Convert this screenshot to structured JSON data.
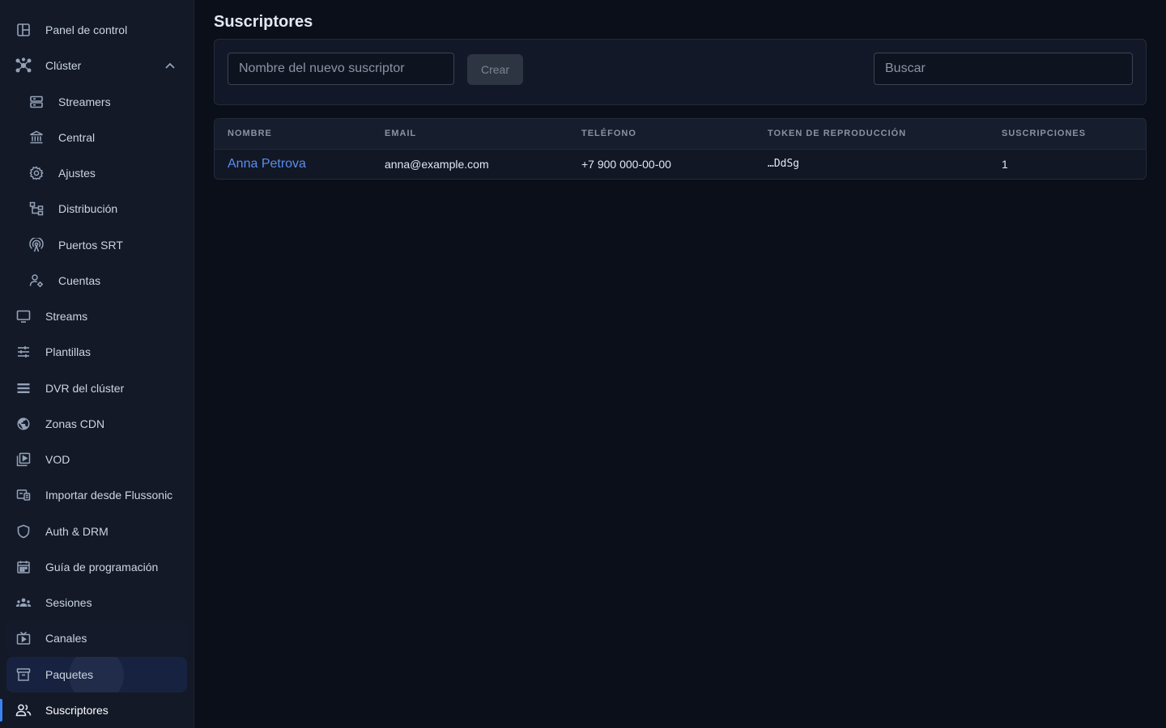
{
  "sidebar": {
    "items": [
      {
        "label": "Panel de control",
        "icon": "dashboard-icon"
      },
      {
        "label": "Clúster",
        "icon": "cluster-icon"
      },
      {
        "label": "Streamers",
        "icon": "server-icon"
      },
      {
        "label": "Central",
        "icon": "bank-icon"
      },
      {
        "label": "Ajustes",
        "icon": "gear-icon"
      },
      {
        "label": "Distribución",
        "icon": "distribution-icon"
      },
      {
        "label": "Puertos SRT",
        "icon": "antenna-icon"
      },
      {
        "label": "Cuentas",
        "icon": "user-settings-icon"
      },
      {
        "label": "Streams",
        "icon": "monitor-icon"
      },
      {
        "label": "Plantillas",
        "icon": "sliders-icon"
      },
      {
        "label": "DVR del clúster",
        "icon": "list-icon"
      },
      {
        "label": "Zonas CDN",
        "icon": "globe-icon"
      },
      {
        "label": "VOD",
        "icon": "video-library-icon"
      },
      {
        "label": "Importar desde Flussonic",
        "icon": "import-icon"
      },
      {
        "label": "Auth & DRM",
        "icon": "shield-icon"
      },
      {
        "label": "Guía de programación",
        "icon": "calendar-icon"
      },
      {
        "label": "Sesiones",
        "icon": "groups-icon"
      },
      {
        "label": "Canales",
        "icon": "tv-icon"
      },
      {
        "label": "Paquetes",
        "icon": "archive-icon"
      },
      {
        "label": "Suscriptores",
        "icon": "people-icon"
      }
    ],
    "active": "Suscriptores",
    "accent_color": "#3b82f6"
  },
  "main": {
    "title": "Suscriptores",
    "new_subscriber_placeholder": "Nombre del nuevo suscriptor",
    "create_label": "Crear",
    "search_placeholder": "Buscar",
    "table": {
      "columns": [
        "NOMBRE",
        "EMAIL",
        "TELÉFONO",
        "TOKEN DE REPRODUCCIÓN",
        "SUSCRIPCIONES"
      ],
      "rows": [
        {
          "name": "Anna Petrova",
          "email": "anna@example.com",
          "phone": "+7 900 000-00-00",
          "token": "…DdSg",
          "subscriptions": "1"
        }
      ]
    },
    "link_color": "#5b8def"
  }
}
